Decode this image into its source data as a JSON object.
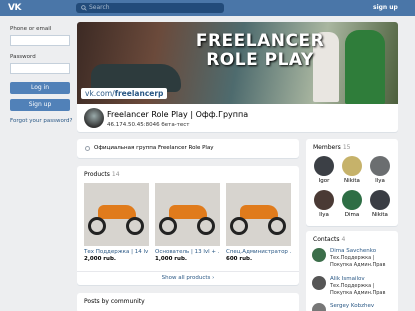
{
  "topbar": {
    "logo": "VK",
    "search_placeholder": "Search",
    "signup": "sign up"
  },
  "sidebar": {
    "phone_label": "Phone or email",
    "password_label": "Password",
    "login_button": "Log in",
    "signup_button": "Sign up",
    "forgot_link": "Forgot your password?"
  },
  "cover": {
    "title_line1": "FREELANCER",
    "title_line2": "ROLE PLAY",
    "url_prefix": "vk.com/",
    "url_name": "freelancerp"
  },
  "group": {
    "name": "Freelancer Role Play | Офф.Группа",
    "status": "46.174.50.45:8046 бета-тест"
  },
  "official": {
    "text": "Официальная группа Freelancer Role Play"
  },
  "products": {
    "title": "Products",
    "count": "14",
    "items": [
      {
        "name": "Тех Поддержка | 14 lv",
        "price": "2,000 rub."
      },
      {
        "name": "Основатель | 13 lvl + ...",
        "price": "1,000 rub."
      },
      {
        "name": "Спец.Администратор ...",
        "price": "600 rub."
      }
    ],
    "show_all": "Show all products"
  },
  "posts": {
    "title": "Posts by community"
  },
  "members": {
    "title": "Members",
    "count": "15",
    "items": [
      {
        "name": "Igor",
        "color": "#3b3f45"
      },
      {
        "name": "Nikita",
        "color": "#c6b26a"
      },
      {
        "name": "Ilya",
        "color": "#6b6e70"
      },
      {
        "name": "Ilya",
        "color": "#4a3a35"
      },
      {
        "name": "Dima",
        "color": "#2e6e45"
      },
      {
        "name": "Nikita",
        "color": "#3a3d44"
      }
    ]
  },
  "contacts": {
    "title": "Contacts",
    "count": "4",
    "items": [
      {
        "name": "Dima Savchenko",
        "role1": "Тех.Поддержка |",
        "role2": "Покупка Админ.Прав",
        "color": "#3c6e4a"
      },
      {
        "name": "Alik Ismailov",
        "role1": "Тех.Поддержка |",
        "role2": "Покупка Админ.Прав",
        "color": "#555"
      },
      {
        "name": "Sergey Kobzhev",
        "role1": "",
        "role2": "",
        "color": "#777"
      }
    ]
  }
}
